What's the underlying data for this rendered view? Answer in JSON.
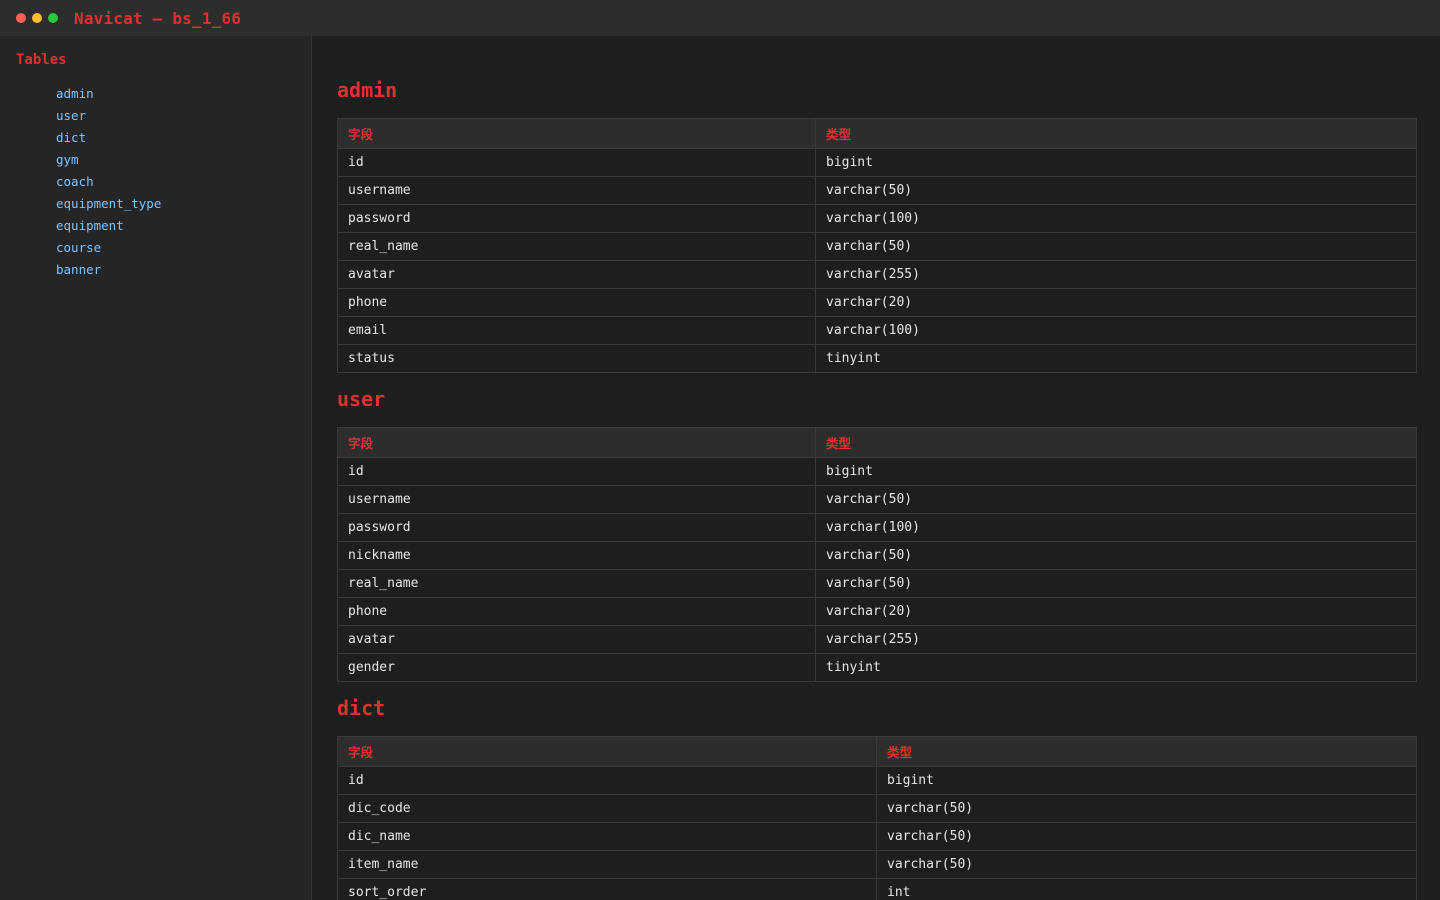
{
  "window": {
    "title": "Navicat — bs_1_66"
  },
  "sidebar": {
    "heading": "Tables",
    "items": [
      "admin",
      "user",
      "dict",
      "gym",
      "coach",
      "equipment_type",
      "equipment",
      "course",
      "banner"
    ]
  },
  "columns": {
    "field": "字段",
    "type": "类型"
  },
  "tables": [
    {
      "name": "admin",
      "rows": [
        [
          "id",
          "bigint"
        ],
        [
          "username",
          "varchar(50)"
        ],
        [
          "password",
          "varchar(100)"
        ],
        [
          "real_name",
          "varchar(50)"
        ],
        [
          "avatar",
          "varchar(255)"
        ],
        [
          "phone",
          "varchar(20)"
        ],
        [
          "email",
          "varchar(100)"
        ],
        [
          "status",
          "tinyint"
        ]
      ]
    },
    {
      "name": "user",
      "rows": [
        [
          "id",
          "bigint"
        ],
        [
          "username",
          "varchar(50)"
        ],
        [
          "password",
          "varchar(100)"
        ],
        [
          "nickname",
          "varchar(50)"
        ],
        [
          "real_name",
          "varchar(50)"
        ],
        [
          "phone",
          "varchar(20)"
        ],
        [
          "avatar",
          "varchar(255)"
        ],
        [
          "gender",
          "tinyint"
        ]
      ]
    },
    {
      "name": "dict",
      "rows": [
        [
          "id",
          "bigint"
        ],
        [
          "dic_code",
          "varchar(50)"
        ],
        [
          "dic_name",
          "varchar(50)"
        ],
        [
          "item_name",
          "varchar(50)"
        ],
        [
          "sort_order",
          "int"
        ]
      ]
    }
  ]
}
